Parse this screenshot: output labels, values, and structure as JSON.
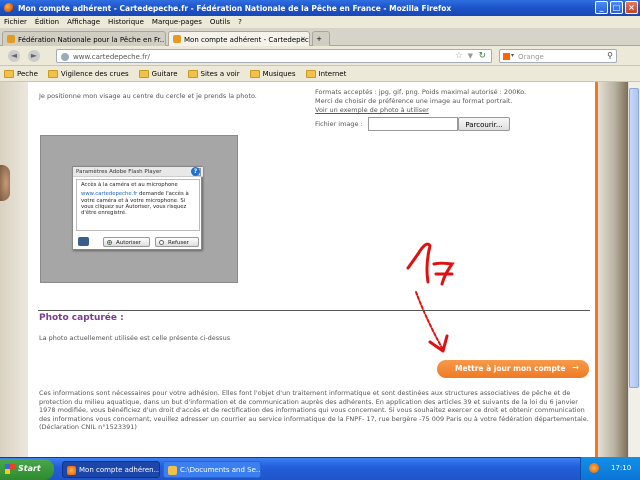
{
  "window": {
    "title": "Mon compte adhérent - Cartedepeche.fr - Fédération Nationale de la Pêche en France - Mozilla Firefox",
    "controls": [
      "_",
      "□",
      "×"
    ]
  },
  "menu": [
    "Fichier",
    "Édition",
    "Affichage",
    "Historique",
    "Marque-pages",
    "Outils",
    "?"
  ],
  "tabs": [
    {
      "label": "Fédération Nationale pour la Pêche en Fr...",
      "active": false
    },
    {
      "label": "Mon compte adhérent - Cartedepeche.fr ...",
      "active": true
    }
  ],
  "new_tab_label": "+",
  "nav": {
    "back": "◄",
    "forward": "►",
    "url": "www.cartedepeche.fr/",
    "search_placeholder": "Orange"
  },
  "bookmarks": [
    "Peche",
    "Vigilence des crues",
    "Guitare",
    "Sites a voir",
    "Musiques",
    "Internet"
  ],
  "page": {
    "camera_instruction": "Je positionne mon visage au centre du cercle et je prends la photo.",
    "formats_line1": "Formats acceptés : jpg, gif, png. Poids maximal autorisé : 200Ko.",
    "formats_line2": "Merci de choisir de préférence une image au format portrait.",
    "example_link": "Voir un exemple de photo à utiliser",
    "file_label": "Fichier image :",
    "file_value": "",
    "browse_button": "Parcourir...",
    "flash": {
      "title": "Paramètres Adobe Flash Player",
      "close": "x",
      "heading": "Accès à la caméra et au microphone",
      "help": "?",
      "site": "www.cartedepeche.fr",
      "body": " demande l'accès à votre caméra et à votre microphone. Si vous cliquez sur Autoriser, vous risquez d'être enregistré.",
      "allow": "Autoriser",
      "deny": "Refuser"
    },
    "annotation": "17",
    "captured_title": "Photo capturée :",
    "captured_text": "La photo actuellement utilisée est celle présente ci-dessus",
    "update_button": "Mettre à jour mon compte",
    "update_arrow": "→",
    "legal_text": "Ces informations sont nécessaires pour votre adhésion. Elles font l'objet d'un traitement informatique et sont destinées aux structures associatives de pêche et de protection du milieu aquatique, dans un but d'information et de communication auprès des adhérents. En application des articles 39 et suivants de la loi du 6 janvier 1978 modifiée, vous bénéficiez d'un droit d'accès et de rectification des informations qui vous concernent. Si vous souhaitez exercer ce droit et obtenir communication des informations vous concernant, veuillez adresser un courrier au service informatique de la FNPF- 17, rue bergère -75 009 Paris ou à votre fédération départementale. (Déclaration CNIL n°1523391)"
  },
  "taskbar": {
    "start": "Start",
    "items": [
      "Mon compte adhéren...",
      "C:\\Documents and Se..."
    ],
    "clock": "17:10"
  },
  "colors": {
    "accent_orange": "#ee7a25",
    "section_purple": "#7a3d8c",
    "annotation_red": "#e01010",
    "xp_blue": "#245edb"
  }
}
